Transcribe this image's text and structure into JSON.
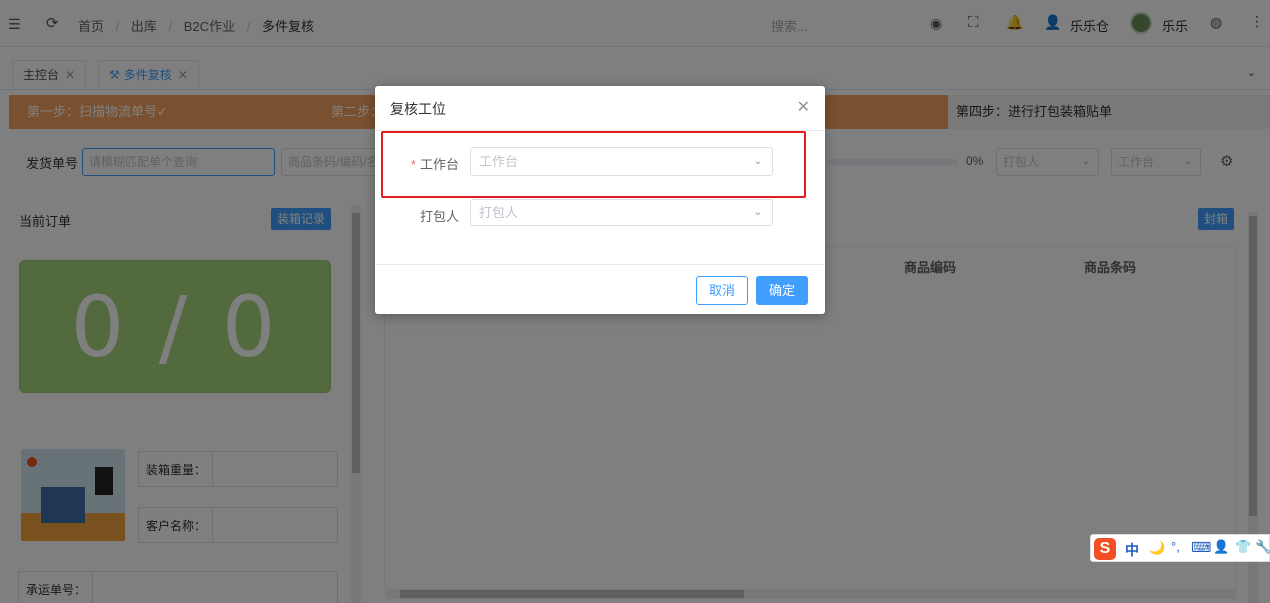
{
  "header": {
    "breadcrumb": [
      "首页",
      "出库",
      "B2C作业",
      "多件复核"
    ],
    "search_placeholder": "搜索...",
    "warehouse": "乐乐仓",
    "user_name": "乐乐"
  },
  "tabs": [
    {
      "label": "主控台"
    },
    {
      "label": "多件复核"
    }
  ],
  "steps": {
    "step1": "第一步：扫描物流单号✓",
    "step2": "第二步：",
    "step4": "第四步：进行打包装箱贴单"
  },
  "filter": {
    "ship_no_label": "发货单号",
    "ship_no_placeholder": "请模糊匹配单个查询",
    "product_placeholder": "商品条码/编码/名",
    "progress_text": "0%",
    "packer_placeholder": "打包人",
    "station_placeholder": "工作台"
  },
  "left": {
    "current_order": "当前订单",
    "pack_record_button": "装箱记录",
    "counter": "0 / 0",
    "weight_label": "装箱重量：",
    "customer_label": "客户名称：",
    "carrier_label": "承运单号："
  },
  "right": {
    "seal_button": "封箱",
    "columns": [
      "商品编码",
      "商品条码"
    ]
  },
  "modal": {
    "title": "复核工位",
    "station_label": "工作台",
    "station_placeholder": "工作台",
    "packer_label": "打包人",
    "packer_placeholder": "打包人",
    "cancel": "取消",
    "confirm": "确定"
  },
  "ime": {
    "items": [
      "中",
      "🌙",
      "°,",
      "⌨",
      "👤",
      "👕",
      "🔧"
    ]
  },
  "colors": {
    "primary": "#409eff",
    "step_bar": "#f4a261",
    "counter_bg": "#a7d47e",
    "highlight": "#e02020"
  }
}
